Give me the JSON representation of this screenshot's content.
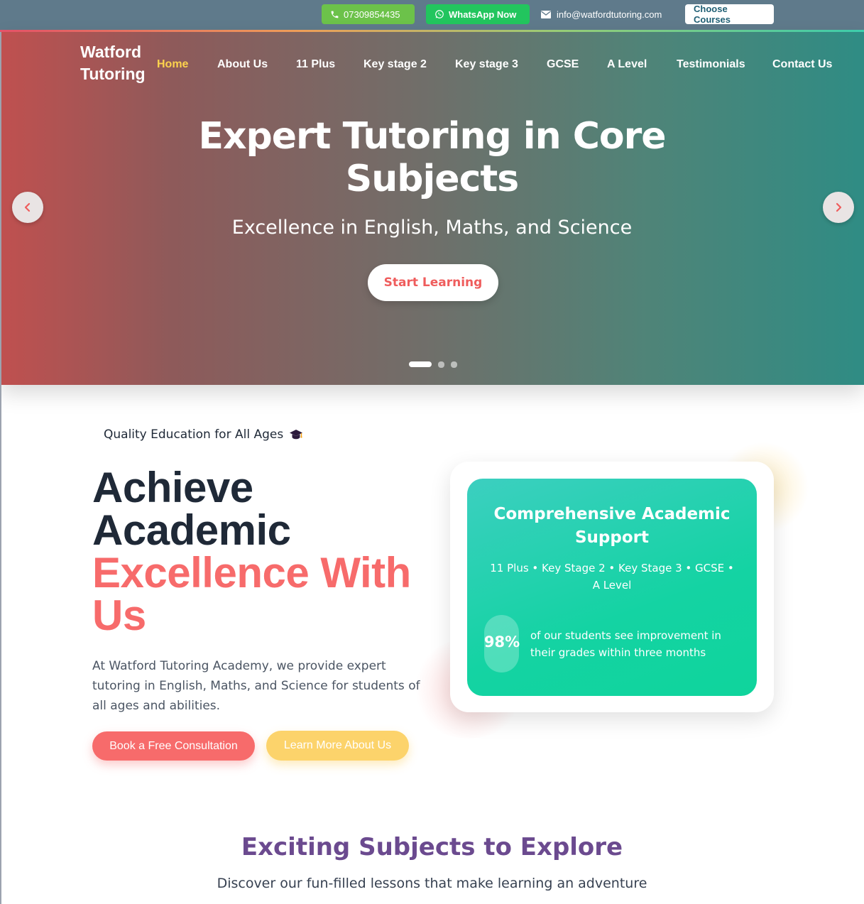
{
  "topbar": {
    "phone": "07309854435",
    "whatsapp": "WhatsApp Now",
    "email": "info@watfordtutoring.com",
    "choose_courses": "Choose Courses",
    "icons": {
      "phone": "phone-icon",
      "whatsapp": "whatsapp-icon",
      "email": "envelope-icon"
    },
    "colors": {
      "bar": "#5f7a8b",
      "phone_btn": "#6cc24a",
      "whatsapp_btn": "#22c55e"
    }
  },
  "header": {
    "logo_line1": "Watford",
    "logo_line2": "Tutoring",
    "nav": [
      "Home",
      "About Us",
      "11 Plus",
      "Key stage 2",
      "Key stage 3",
      "GCSE",
      "A Level",
      "Testimonials",
      "Contact Us"
    ],
    "active_nav": "Home",
    "active_color": "#fcd34d"
  },
  "hero": {
    "title_line1": "Expert Tutoring in Core",
    "title_line2": "Subjects",
    "subtitle": "Excellence in English, Maths, and Science",
    "cta": "Start Learning",
    "slides": 3,
    "active_slide": 1,
    "icons": {
      "prev": "chevron-left-icon",
      "next": "chevron-right-icon"
    }
  },
  "about": {
    "tagline": "Quality Education for All Ages",
    "tagline_icon": "graduation-cap-icon",
    "headline_line1": "Achieve",
    "headline_line2": "Academic",
    "headline_accent1": "Excellence With",
    "headline_accent2": "Us",
    "paragraph": "At Watford Tutoring Academy, we provide expert tutoring in English, Maths, and Science for students of all ages and abilities.",
    "book_button": "Book a Free Consultation",
    "learn_button": "Learn More About Us",
    "accent_color": "#f76b6b"
  },
  "support_card": {
    "title": "Comprehensive Academic Support",
    "levels": "11 Plus • Key Stage 2 • Key Stage 3 • GCSE • A Level",
    "stat_value": "98%",
    "stat_text": "of our students see improvement in their grades within three months"
  },
  "subjects": {
    "title": "Exciting Subjects to Explore",
    "subtitle": "Discover our fun-filled lessons that make learning an adventure"
  }
}
